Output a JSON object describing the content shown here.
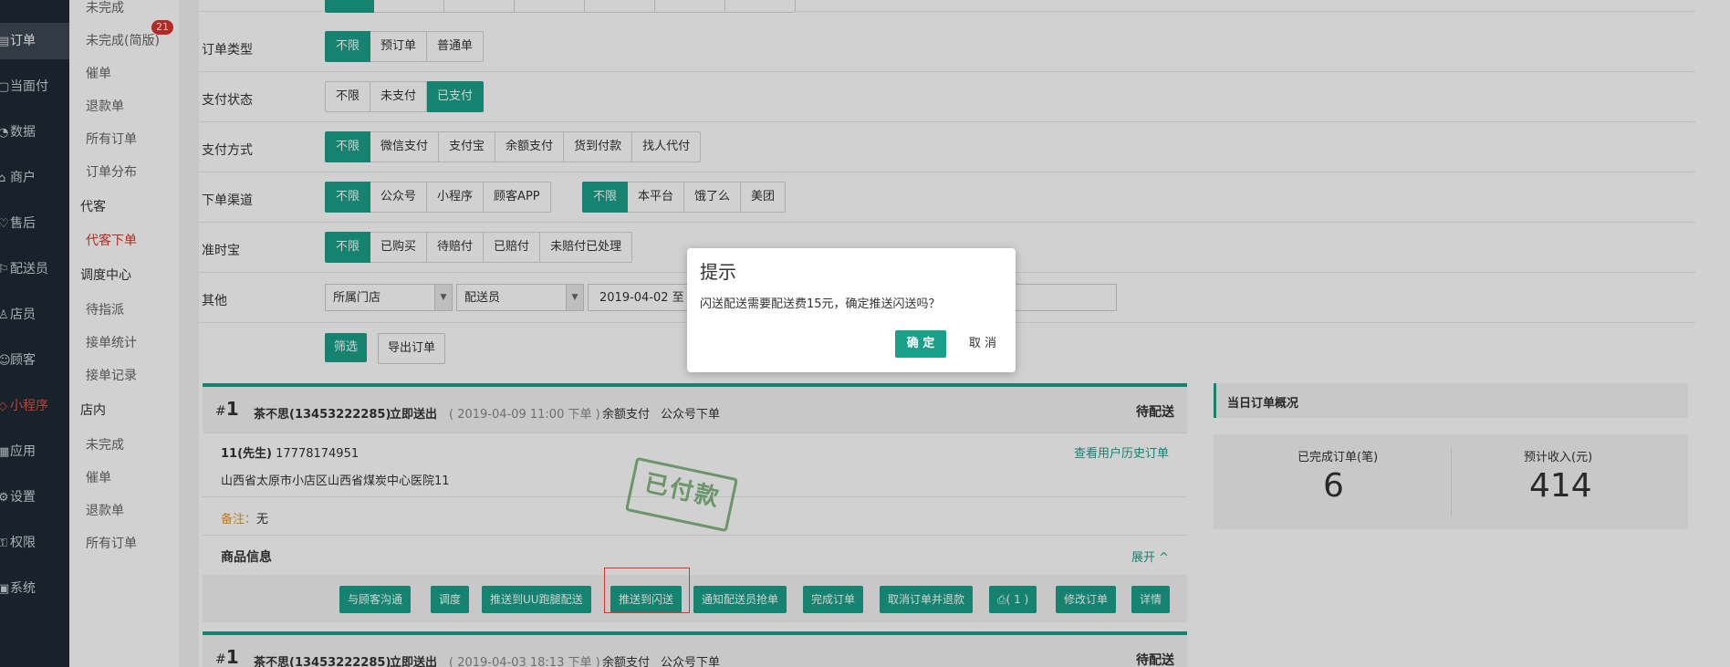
{
  "left_nav": [
    {
      "label": "订单",
      "icon": "order-icon"
    },
    {
      "label": "当面付",
      "icon": "face-pay-icon"
    },
    {
      "label": "数据",
      "icon": "data-icon"
    },
    {
      "label": "商户",
      "icon": "merchant-icon"
    },
    {
      "label": "售后",
      "icon": "after-sale-icon"
    },
    {
      "label": "配送员",
      "icon": "courier-icon"
    },
    {
      "label": "店员",
      "icon": "clerk-icon"
    },
    {
      "label": "顾客",
      "icon": "customer-icon"
    },
    {
      "label": "小程序",
      "icon": "miniapp-icon"
    },
    {
      "label": "应用",
      "icon": "app-icon"
    },
    {
      "label": "设置",
      "icon": "settings-icon"
    },
    {
      "label": "权限",
      "icon": "permission-icon"
    },
    {
      "label": "系统",
      "icon": "system-icon"
    }
  ],
  "sub_nav": {
    "items_top": [
      "未完成",
      "未完成(简版)",
      "催单",
      "退款单",
      "所有订单",
      "订单分布"
    ],
    "badge_count": "21",
    "head_proxy": "代客",
    "proxy_item": "代客下单",
    "head_dispatch": "调度中心",
    "dispatch_items": [
      "待指派",
      "接单统计",
      "接单记录"
    ],
    "head_store": "店内",
    "store_items": [
      "未完成",
      "催单",
      "退款单",
      "所有订单"
    ]
  },
  "filters": {
    "order_type": {
      "label": "订单类型",
      "options": [
        "不限",
        "预订单",
        "普通单"
      ]
    },
    "pay_status": {
      "label": "支付状态",
      "options": [
        "不限",
        "未支付",
        "已支付"
      ]
    },
    "pay_method": {
      "label": "支付方式",
      "options": [
        "不限",
        "微信支付",
        "支付宝",
        "余额支付",
        "货到付款",
        "找人代付"
      ]
    },
    "channel": {
      "label": "下单渠道",
      "options": [
        "不限",
        "公众号",
        "小程序",
        "顾客APP"
      ],
      "options2": [
        "不限",
        "本平台",
        "饿了么",
        "美团"
      ]
    },
    "ontime": {
      "label": "准时宝",
      "options": [
        "不限",
        "已购买",
        "待赔付",
        "已赔付",
        "未赔付已处理"
      ]
    },
    "other": {
      "label": "其他",
      "store_select": "所属门店",
      "courier_select": "配送员",
      "date_value": "2019-04-02 至"
    }
  },
  "buttons": {
    "filter": "筛选",
    "export": "导出订单"
  },
  "orders": [
    {
      "num": "1",
      "customer": "茶不思(13453222285)",
      "delivery": "立即送出",
      "time": "( 2019-04-09 11:00 下单 )",
      "pay": "余额支付",
      "channel": "公众号下单",
      "status": "待配送",
      "contact": "11(先生)",
      "phone": "17778174951",
      "history_link": "查看用户历史订单",
      "address": "山西省太原市小店区山西省煤炭中心医院11",
      "remark_label": "备注：",
      "remark_value": "无",
      "goods_label": "商品信息",
      "expand": "展开 ^",
      "stamp": "已付款",
      "actions": [
        "与顾客沟通",
        "调度",
        "推送到UU跑腿配送",
        "推送到闪送",
        "通知配送员抢单",
        "完成订单",
        "取消订单并退款",
        "( 1 )",
        "修改订单",
        "详情"
      ]
    },
    {
      "num": "1",
      "customer": "茶不思(13453222285)",
      "delivery": "立即送出",
      "time": "( 2019-04-03 18:13 下单 )",
      "pay": "余额支付",
      "channel": "公众号下单",
      "status": "待配送"
    }
  ],
  "summary": {
    "title": "当日订单概况",
    "completed_label": "已完成订单(笔)",
    "completed_value": "6",
    "income_label": "预计收入(元)",
    "income_value": "414"
  },
  "modal": {
    "title": "提示",
    "message": "闪送配送需要配送费15元，确定推送闪送吗？",
    "ok": "确 定",
    "cancel": "取 消"
  },
  "colors": {
    "primary": "#1aa089",
    "nav_bg": "#1f2a35",
    "alert_red": "#d9342b"
  }
}
